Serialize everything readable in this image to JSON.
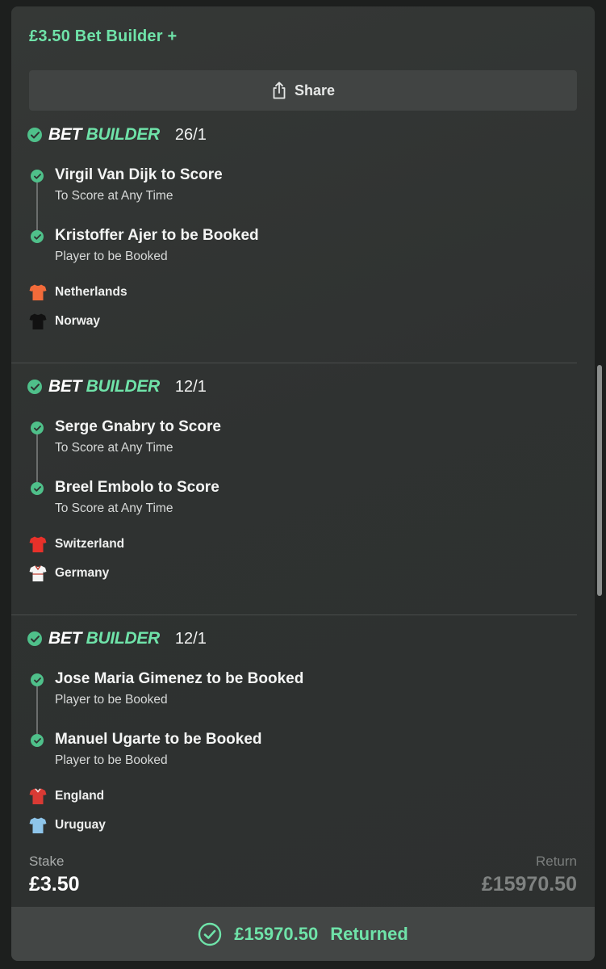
{
  "header": {
    "title": "£3.50 Bet Builder +",
    "share_label": "Share"
  },
  "bet_builders": [
    {
      "logo_part1": "BET",
      "logo_part2": "BUILDER",
      "odds": "26/1",
      "legs": [
        {
          "title": "Virgil Van Dijk to Score",
          "market": "To Score at Any Time"
        },
        {
          "title": "Kristoffer Ajer to be Booked",
          "market": "Player to be Booked"
        }
      ],
      "teams": [
        {
          "name": "Netherlands",
          "shirt_color": "#f26b3a",
          "shirt_trim": "#f26b3a"
        },
        {
          "name": "Norway",
          "shirt_color": "#111111",
          "shirt_trim": "#111111"
        }
      ]
    },
    {
      "logo_part1": "BET",
      "logo_part2": "BUILDER",
      "odds": "12/1",
      "legs": [
        {
          "title": "Serge Gnabry to Score",
          "market": "To Score at Any Time"
        },
        {
          "title": "Breel Embolo to Score",
          "market": "To Score at Any Time"
        }
      ],
      "teams": [
        {
          "name": "Switzerland",
          "shirt_color": "#e8312a",
          "shirt_trim": "#e8312a"
        },
        {
          "name": "Germany",
          "shirt_color": "#f5f5f5",
          "shirt_trim": "#c0392b"
        }
      ]
    },
    {
      "logo_part1": "BET",
      "logo_part2": "BUILDER",
      "odds": "12/1",
      "legs": [
        {
          "title": "Jose Maria Gimenez to be Booked",
          "market": "Player to be Booked"
        },
        {
          "title": "Manuel Ugarte to be Booked",
          "market": "Player to be Booked"
        }
      ],
      "teams": [
        {
          "name": "England",
          "shirt_color": "#d93a34",
          "shirt_trim": "#f0f0f0"
        },
        {
          "name": "Uruguay",
          "shirt_color": "#8ec5ea",
          "shirt_trim": "#8ec5ea"
        }
      ]
    }
  ],
  "summary": {
    "stake_label": "Stake",
    "stake_value": "£3.50",
    "return_label": "Return",
    "return_value": "£15970.50",
    "returned_amount": "£15970.50",
    "returned_text": "Returned"
  },
  "colors": {
    "accent_green": "#6fe3a9",
    "check_green": "#4fc08a",
    "card_bg": "#323534"
  }
}
